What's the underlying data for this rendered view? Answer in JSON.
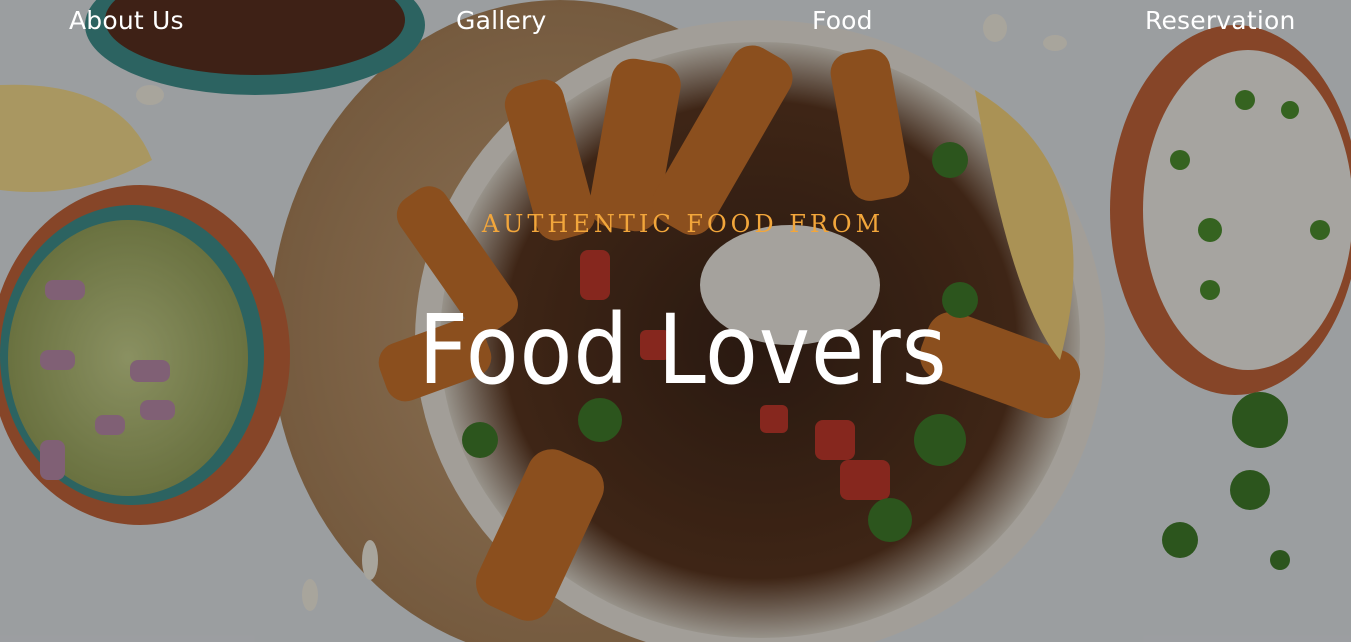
{
  "nav": {
    "items": [
      {
        "label": "About Us"
      },
      {
        "label": "Gallery"
      },
      {
        "label": "Food"
      },
      {
        "label": "Reservation"
      }
    ]
  },
  "hero": {
    "tagline": "AUTHENTIC FOOD FROM",
    "title": "Food Lovers",
    "accent_color": "#f2a63b"
  }
}
